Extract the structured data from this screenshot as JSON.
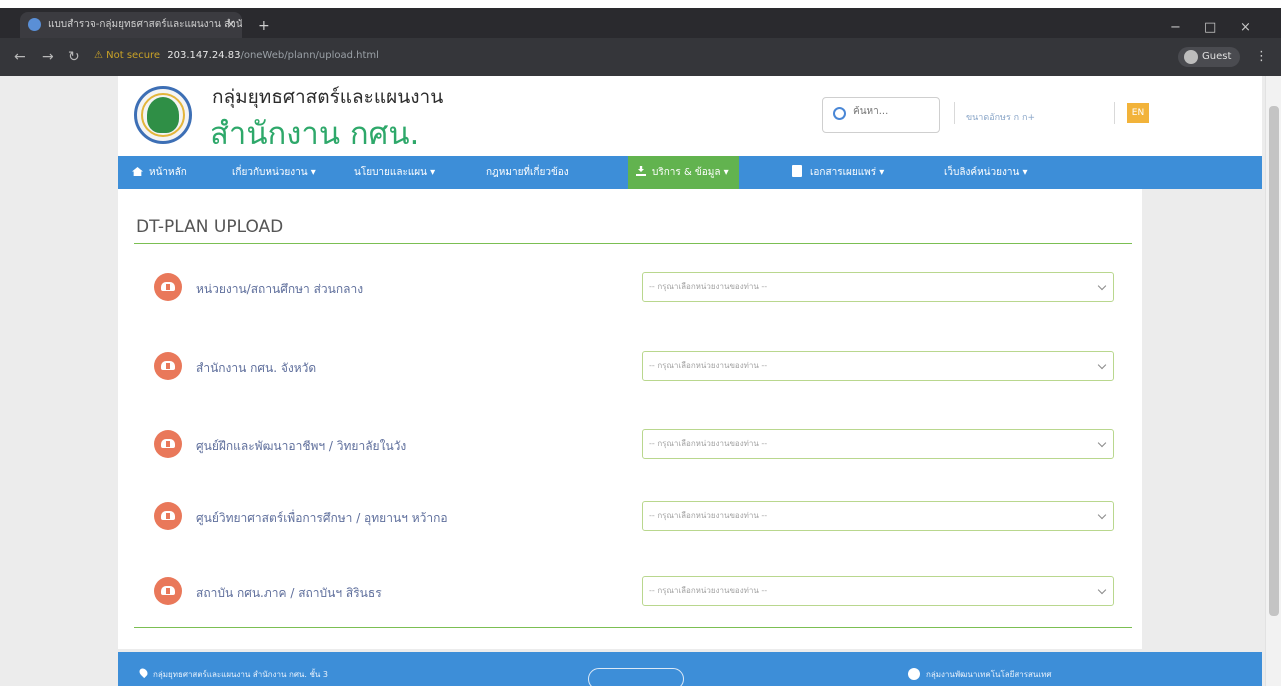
{
  "browser": {
    "tab_title": "แบบสำรวจ-กลุ่มยุทธศาสตร์และแผนงาน สำนักงาน กศน.",
    "new_tab": "+",
    "tab_close": "×",
    "security": "⚠ Not secure",
    "url_host": "203.147.24.83",
    "url_path": "/oneWeb/plann/upload.html",
    "profile": "Guest",
    "window_controls": {
      "minimize": "−",
      "maximize": "□",
      "close": "×"
    }
  },
  "header": {
    "org_name": "กลุ่มยุทธศาสตร์และแผนงาน",
    "office_name": "สำนักงาน กศน.",
    "search_placeholder": "ค้นหา...",
    "font_size_label": "ขนาดอักษร  ก  ก+",
    "lang_button": "EN"
  },
  "nav": {
    "items": [
      {
        "label": "หน้าหลัก"
      },
      {
        "label": "เกี่ยวกับหน่วยงาน ▾"
      },
      {
        "label": "นโยบายและแผน ▾"
      },
      {
        "label": "กฎหมายที่เกี่ยวข้อง"
      },
      {
        "label": "บริการ & ข้อมูล ▾"
      },
      {
        "label": "เอกสารเผยแพร่ ▾"
      },
      {
        "label": "เว็บลิงค์หน่วยงาน ▾"
      }
    ]
  },
  "page": {
    "title": "DT-PLAN UPLOAD",
    "rows": [
      {
        "label": "หน่วยงาน/สถานศึกษา ส่วนกลาง",
        "placeholder": "-- กรุณาเลือกหน่วยงานของท่าน --"
      },
      {
        "label": "สำนักงาน กศน. จังหวัด",
        "placeholder": "-- กรุณาเลือกหน่วยงานของท่าน --"
      },
      {
        "label": "ศูนย์ฝึกและพัฒนาอาชีพฯ / วิทยาลัยในวัง",
        "placeholder": "-- กรุณาเลือกหน่วยงานของท่าน --"
      },
      {
        "label": "ศูนย์วิทยาศาสตร์เพื่อการศึกษา / อุทยานฯ หว้ากอ",
        "placeholder": "-- กรุณาเลือกหน่วยงานของท่าน --"
      },
      {
        "label": "สถาบัน กศน.ภาค / สถาบันฯ สิรินธร",
        "placeholder": "-- กรุณาเลือกหน่วยงานของท่าน --"
      }
    ]
  },
  "footer": {
    "address": "กลุ่มยุทธศาสตร์และแผนงาน สำนักงาน กศน. ชั้น 3",
    "social": "กลุ่มงานพัฒนาเทคโนโลยีสารสนเทศ"
  },
  "colors": {
    "nav_blue": "#3d8ed8",
    "active_green": "#62b34f",
    "title_green": "#2ea86a",
    "icon_orange": "#e9785a"
  }
}
